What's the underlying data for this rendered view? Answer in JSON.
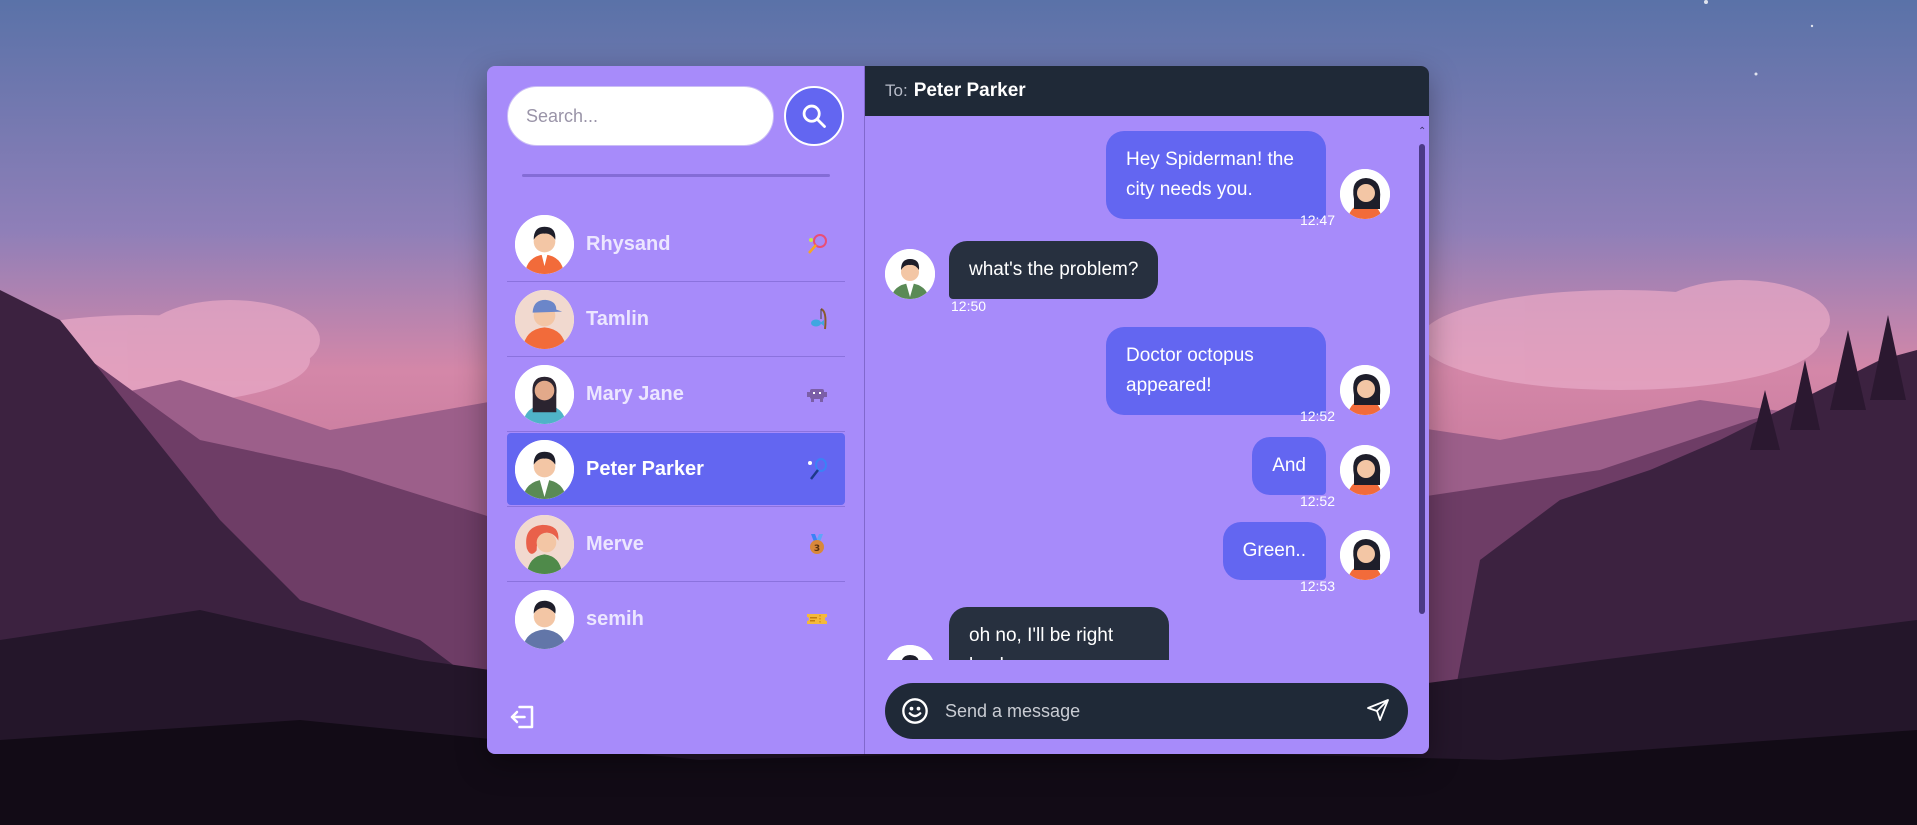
{
  "search": {
    "placeholder": "Search..."
  },
  "contacts": [
    {
      "name": "Rhysand",
      "status_icon": "tennis-racket-icon",
      "avatar": "man-orange-shirt-avatar"
    },
    {
      "name": "Tamlin",
      "status_icon": "fishing-rod-icon",
      "avatar": "man-cap-avatar"
    },
    {
      "name": "Mary Jane",
      "status_icon": "space-invader-icon",
      "avatar": "woman-blue-shirt-avatar"
    },
    {
      "name": "Peter Parker",
      "status_icon": "badminton-icon",
      "avatar": "man-green-jacket-avatar",
      "active": true
    },
    {
      "name": "Merve",
      "status_icon": "medal-icon",
      "avatar": "woman-red-hair-avatar"
    },
    {
      "name": "semih",
      "status_icon": "ticket-icon",
      "avatar": "man-blue-shirt-avatar"
    }
  ],
  "chat": {
    "to_label": "To:",
    "to_name": "Peter Parker",
    "messages": [
      {
        "direction": "out",
        "text": "Hey Spiderman! the city needs you.",
        "time": "12:47"
      },
      {
        "direction": "in",
        "text": "what's the problem?",
        "time": "12:50"
      },
      {
        "direction": "out",
        "text": "Doctor octopus appeared!",
        "time": "12:52"
      },
      {
        "direction": "out",
        "text": "And",
        "time": "12:52"
      },
      {
        "direction": "out",
        "text": "Green..",
        "time": "12:53"
      },
      {
        "direction": "in",
        "text": "oh no, I'll be right back",
        "time": ""
      }
    ],
    "composer_placeholder": "Send a message"
  },
  "colors": {
    "accent": "#6366f1",
    "panel": "#a78bfa",
    "dark": "#1f2937",
    "incoming_bubble": "#27303f"
  }
}
